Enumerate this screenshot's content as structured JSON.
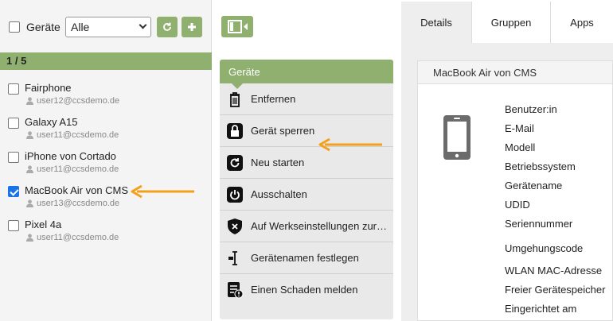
{
  "toolbar": {
    "select_all_label": "Geräte",
    "filter_value": "Alle",
    "refresh_icon": "refresh-icon",
    "add_icon": "plus-icon"
  },
  "list": {
    "count": "1 / 5",
    "devices": [
      {
        "name": "Fairphone",
        "user": "user12@ccsdemo.de",
        "checked": false
      },
      {
        "name": "Galaxy A15",
        "user": "user11@ccsdemo.de",
        "checked": false
      },
      {
        "name": "iPhone von Cortado",
        "user": "user11@ccsdemo.de",
        "checked": false
      },
      {
        "name": "MacBook Air von CMS",
        "user": "user13@ccsdemo.de",
        "checked": true
      },
      {
        "name": "Pixel 4a",
        "user": "user11@ccsdemo.de",
        "checked": false
      }
    ]
  },
  "actions": {
    "header": "Geräte",
    "items": [
      {
        "label": "Entfernen",
        "icon": "trash-icon"
      },
      {
        "label": "Gerät sperren",
        "icon": "lock-icon"
      },
      {
        "label": "Neu starten",
        "icon": "restart-icon"
      },
      {
        "label": "Ausschalten",
        "icon": "power-icon"
      },
      {
        "label": "Auf Werkseinstellungen zurücksetzen",
        "icon": "shield-x-icon"
      },
      {
        "label": "Gerätenamen festlegen",
        "icon": "text-cursor-icon"
      },
      {
        "label": "Einen Schaden melden",
        "icon": "damage-report-icon"
      }
    ]
  },
  "details": {
    "tabs": [
      "Details",
      "Gruppen",
      "Apps"
    ],
    "active_tab": "Details",
    "title": "MacBook Air von CMS",
    "fields": [
      "Benutzer:in",
      "E-Mail",
      "Modell",
      "Betriebssystem",
      "Gerätename",
      "UDID",
      "Seriennummer",
      "Umgehungscode",
      "WLAN MAC-Adresse",
      "Freier Gerätespeicher",
      "Eingerichtet am"
    ]
  },
  "colors": {
    "accent": "#8fb06e",
    "arrow": "#f5a01a",
    "checkbox": "#1a73e8"
  }
}
